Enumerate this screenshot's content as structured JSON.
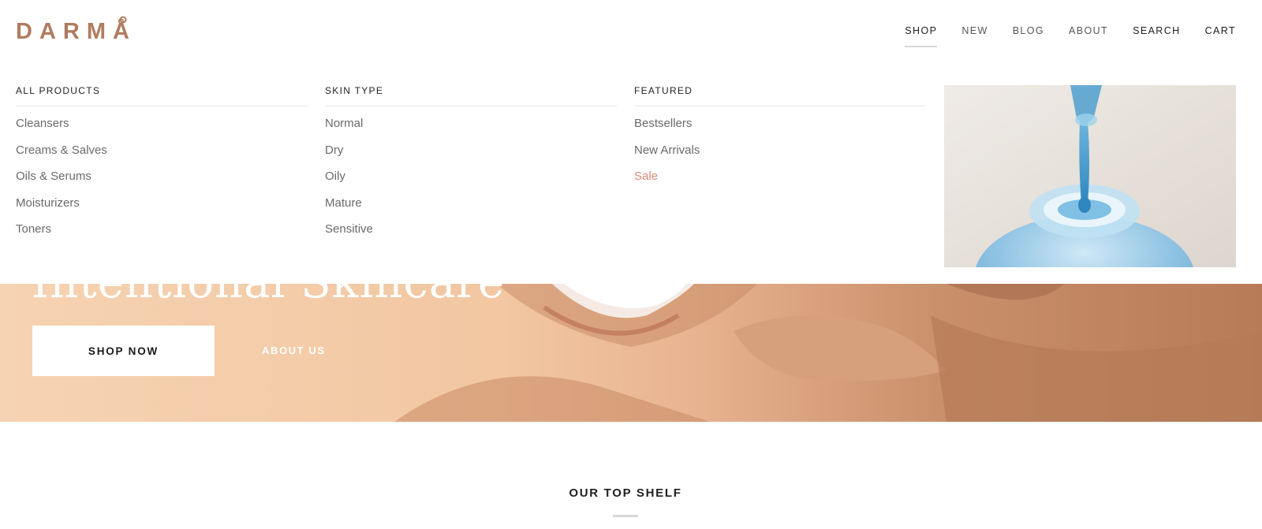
{
  "brand": {
    "logo_text": "DARMÅ",
    "logo_color": "#b07c60"
  },
  "nav": {
    "items": [
      {
        "label": "SHOP",
        "active": true
      },
      {
        "label": "NEW",
        "active": false
      },
      {
        "label": "BLOG",
        "active": false
      },
      {
        "label": "ABOUT",
        "active": false
      },
      {
        "label": "SEARCH",
        "active": false
      },
      {
        "label": "CART",
        "active": false
      }
    ]
  },
  "mega_menu": {
    "columns": [
      {
        "heading": "ALL PRODUCTS",
        "items": [
          "Cleansers",
          "Creams & Salves",
          "Oils & Serums",
          "Moisturizers",
          "Toners"
        ]
      },
      {
        "heading": "SKIN TYPE",
        "items": [
          "Normal",
          "Dry",
          "Oily",
          "Mature",
          "Sensitive"
        ]
      },
      {
        "heading": "FEATURED",
        "items": [
          "Bestsellers",
          "New Arrivals",
          "Sale"
        ]
      }
    ],
    "sale_color": "#d98a74"
  },
  "hero": {
    "title": "Intentional Skincare",
    "primary_button": "SHOP NOW",
    "secondary_link": "ABOUT US"
  },
  "section": {
    "title": "OUR TOP SHELF"
  }
}
